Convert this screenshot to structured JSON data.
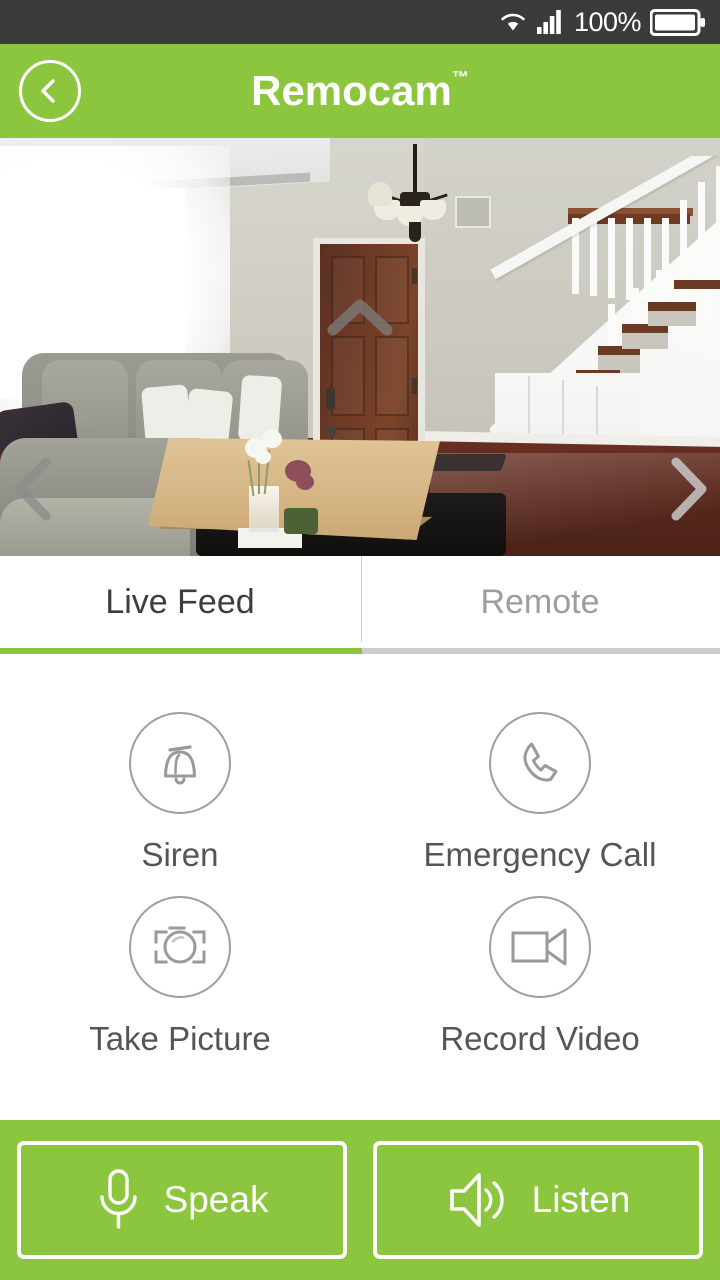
{
  "status_bar": {
    "wifi_icon": "wifi-icon",
    "signal_icon": "cellular-signal-icon",
    "battery_percent": "100%",
    "battery_icon": "battery-full-icon",
    "background_color": "#3b3b3b"
  },
  "header": {
    "title": "Remocam",
    "trademark": "™",
    "back_icon": "chevron-left-icon",
    "background_color": "#8cc63f",
    "text_color": "#ffffff"
  },
  "video_feed": {
    "description": "Live camera view of a living room with sofa, coffee table, front door and staircase",
    "pan_controls": [
      {
        "name": "pan-up",
        "icon": "chevron-up-icon"
      },
      {
        "name": "pan-down",
        "icon": "chevron-down-icon"
      },
      {
        "name": "pan-left",
        "icon": "chevron-left-icon"
      },
      {
        "name": "pan-right",
        "icon": "chevron-right-icon"
      }
    ]
  },
  "tabs": [
    {
      "label": "Live Feed",
      "active": true,
      "underline_color": "#8cc63f"
    },
    {
      "label": "Remote",
      "active": false,
      "underline_color": "#cdcdcd"
    }
  ],
  "actions": [
    {
      "label": "Siren",
      "icon": "bell-icon"
    },
    {
      "label": "Emergency Call",
      "icon": "phone-icon"
    },
    {
      "label": "Take Picture",
      "icon": "camera-icon"
    },
    {
      "label": "Record Video",
      "icon": "video-camera-icon"
    }
  ],
  "bottom_bar": {
    "background_color": "#8cc63f",
    "buttons": [
      {
        "label": "Speak",
        "icon": "microphone-icon"
      },
      {
        "label": "Listen",
        "icon": "speaker-icon"
      }
    ]
  }
}
